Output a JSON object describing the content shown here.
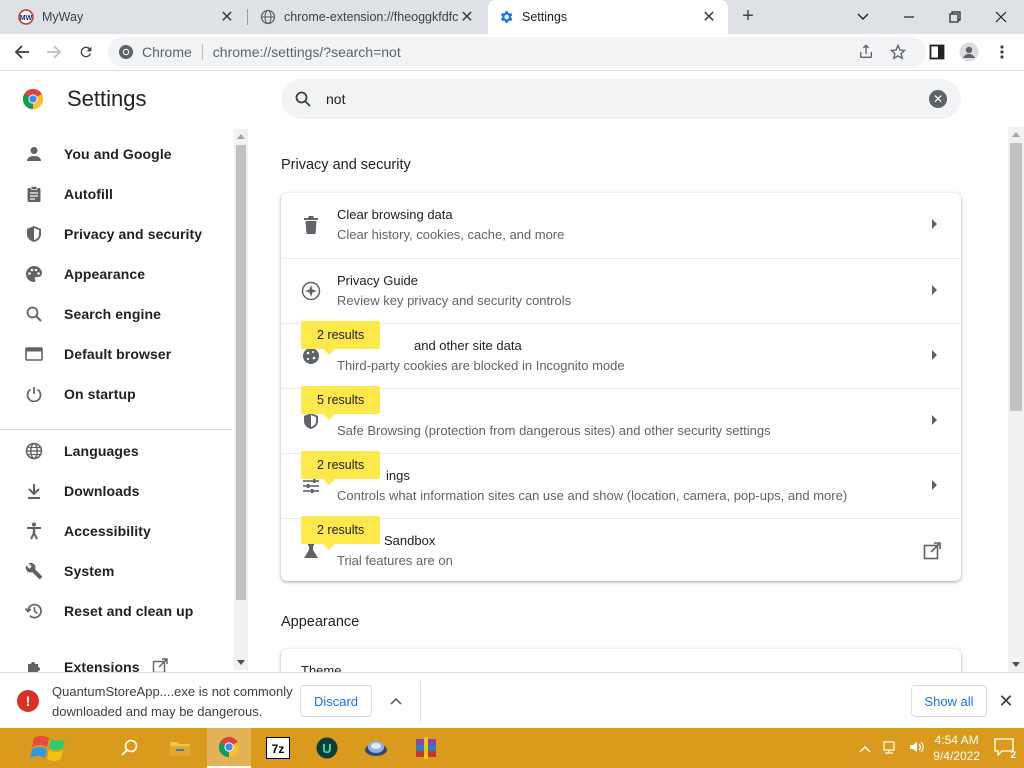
{
  "tabs": [
    {
      "title": "MyWay",
      "active": false
    },
    {
      "title": "chrome-extension://fheoggkfdfc",
      "active": false
    },
    {
      "title": "Settings",
      "active": true
    }
  ],
  "omnibox": {
    "scheme_label": "Chrome",
    "url": "chrome://settings/?search=not"
  },
  "settings": {
    "title": "Settings",
    "search": {
      "value": "not"
    }
  },
  "sidebar": {
    "items": [
      {
        "label": "You and Google",
        "icon": "person-icon"
      },
      {
        "label": "Autofill",
        "icon": "clipboard-icon"
      },
      {
        "label": "Privacy and security",
        "icon": "shield-icon"
      },
      {
        "label": "Appearance",
        "icon": "palette-icon"
      },
      {
        "label": "Search engine",
        "icon": "search-icon"
      },
      {
        "label": "Default browser",
        "icon": "browser-icon"
      },
      {
        "label": "On startup",
        "icon": "power-icon"
      },
      {
        "label": "Languages",
        "icon": "globe-icon"
      },
      {
        "label": "Downloads",
        "icon": "download-icon"
      },
      {
        "label": "Accessibility",
        "icon": "accessibility-icon"
      },
      {
        "label": "System",
        "icon": "wrench-icon"
      },
      {
        "label": "Reset and clean up",
        "icon": "history-icon"
      },
      {
        "label": "Extensions",
        "icon": "puzzle-icon"
      }
    ]
  },
  "main": {
    "section1_title": "Privacy and security",
    "rows": [
      {
        "title": "Clear browsing data",
        "subtitle": "Clear history, cookies, cache, and more",
        "icon": "trash-icon",
        "bubble": ""
      },
      {
        "title": "Privacy Guide",
        "subtitle": "Review key privacy and security controls",
        "icon": "compass-icon",
        "bubble": ""
      },
      {
        "title": "and other site data",
        "subtitle": "Third-party cookies are blocked in Incognito mode",
        "icon": "cookie-icon",
        "bubble": "2 results"
      },
      {
        "title": "",
        "subtitle": "Safe Browsing (protection from dangerous sites) and other security settings",
        "icon": "shield-icon",
        "bubble": "5 results"
      },
      {
        "title": "ings",
        "subtitle": "Controls what information sites can use and show (location, camera, pop-ups, and more)",
        "icon": "sliders-icon",
        "bubble": "2 results"
      },
      {
        "title": "Sandbox",
        "subtitle": "Trial features are on",
        "icon": "flask-icon",
        "bubble": "2 results"
      }
    ],
    "section2_title": "Appearance",
    "section2_first_row": "Theme"
  },
  "download_bar": {
    "warning": "QuantumStoreApp....exe is not commonly downloaded and may be dangerous.",
    "discard_label": "Discard",
    "show_all_label": "Show all"
  },
  "taskbar": {
    "time": "4:54 AM",
    "date": "9/4/2022",
    "notification_count": "2",
    "apps": [
      "search-icon",
      "file-explorer-icon",
      "chrome-icon",
      "7zip-icon",
      "u-app-icon",
      "network-app-icon",
      "winrar-icon"
    ]
  },
  "colors": {
    "accent": "#1a73e8",
    "highlight_bubble": "#ffe84b",
    "taskbar": "#d99a1e",
    "warning": "#d93025"
  }
}
